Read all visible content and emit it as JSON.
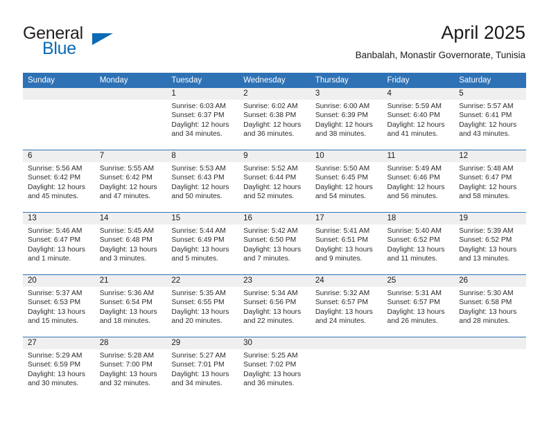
{
  "brand": {
    "name_part1": "General",
    "name_part2": "Blue",
    "triangle_color": "#0a6ab5"
  },
  "header": {
    "title": "April 2025",
    "subtitle": "Banbalah, Monastir Governorate, Tunisia"
  },
  "theme": {
    "header_blue": "#2e72b5",
    "daynum_band": "#efefef",
    "text": "#1a1a1a"
  },
  "weekday_headers": [
    "Sunday",
    "Monday",
    "Tuesday",
    "Wednesday",
    "Thursday",
    "Friday",
    "Saturday"
  ],
  "weeks": [
    [
      {
        "day": "",
        "sunrise": "",
        "sunset": "",
        "daylight1": "",
        "daylight2": ""
      },
      {
        "day": "",
        "sunrise": "",
        "sunset": "",
        "daylight1": "",
        "daylight2": ""
      },
      {
        "day": "1",
        "sunrise": "Sunrise: 6:03 AM",
        "sunset": "Sunset: 6:37 PM",
        "daylight1": "Daylight: 12 hours",
        "daylight2": "and 34 minutes."
      },
      {
        "day": "2",
        "sunrise": "Sunrise: 6:02 AM",
        "sunset": "Sunset: 6:38 PM",
        "daylight1": "Daylight: 12 hours",
        "daylight2": "and 36 minutes."
      },
      {
        "day": "3",
        "sunrise": "Sunrise: 6:00 AM",
        "sunset": "Sunset: 6:39 PM",
        "daylight1": "Daylight: 12 hours",
        "daylight2": "and 38 minutes."
      },
      {
        "day": "4",
        "sunrise": "Sunrise: 5:59 AM",
        "sunset": "Sunset: 6:40 PM",
        "daylight1": "Daylight: 12 hours",
        "daylight2": "and 41 minutes."
      },
      {
        "day": "5",
        "sunrise": "Sunrise: 5:57 AM",
        "sunset": "Sunset: 6:41 PM",
        "daylight1": "Daylight: 12 hours",
        "daylight2": "and 43 minutes."
      }
    ],
    [
      {
        "day": "6",
        "sunrise": "Sunrise: 5:56 AM",
        "sunset": "Sunset: 6:42 PM",
        "daylight1": "Daylight: 12 hours",
        "daylight2": "and 45 minutes."
      },
      {
        "day": "7",
        "sunrise": "Sunrise: 5:55 AM",
        "sunset": "Sunset: 6:42 PM",
        "daylight1": "Daylight: 12 hours",
        "daylight2": "and 47 minutes."
      },
      {
        "day": "8",
        "sunrise": "Sunrise: 5:53 AM",
        "sunset": "Sunset: 6:43 PM",
        "daylight1": "Daylight: 12 hours",
        "daylight2": "and 50 minutes."
      },
      {
        "day": "9",
        "sunrise": "Sunrise: 5:52 AM",
        "sunset": "Sunset: 6:44 PM",
        "daylight1": "Daylight: 12 hours",
        "daylight2": "and 52 minutes."
      },
      {
        "day": "10",
        "sunrise": "Sunrise: 5:50 AM",
        "sunset": "Sunset: 6:45 PM",
        "daylight1": "Daylight: 12 hours",
        "daylight2": "and 54 minutes."
      },
      {
        "day": "11",
        "sunrise": "Sunrise: 5:49 AM",
        "sunset": "Sunset: 6:46 PM",
        "daylight1": "Daylight: 12 hours",
        "daylight2": "and 56 minutes."
      },
      {
        "day": "12",
        "sunrise": "Sunrise: 5:48 AM",
        "sunset": "Sunset: 6:47 PM",
        "daylight1": "Daylight: 12 hours",
        "daylight2": "and 58 minutes."
      }
    ],
    [
      {
        "day": "13",
        "sunrise": "Sunrise: 5:46 AM",
        "sunset": "Sunset: 6:47 PM",
        "daylight1": "Daylight: 13 hours",
        "daylight2": "and 1 minute."
      },
      {
        "day": "14",
        "sunrise": "Sunrise: 5:45 AM",
        "sunset": "Sunset: 6:48 PM",
        "daylight1": "Daylight: 13 hours",
        "daylight2": "and 3 minutes."
      },
      {
        "day": "15",
        "sunrise": "Sunrise: 5:44 AM",
        "sunset": "Sunset: 6:49 PM",
        "daylight1": "Daylight: 13 hours",
        "daylight2": "and 5 minutes."
      },
      {
        "day": "16",
        "sunrise": "Sunrise: 5:42 AM",
        "sunset": "Sunset: 6:50 PM",
        "daylight1": "Daylight: 13 hours",
        "daylight2": "and 7 minutes."
      },
      {
        "day": "17",
        "sunrise": "Sunrise: 5:41 AM",
        "sunset": "Sunset: 6:51 PM",
        "daylight1": "Daylight: 13 hours",
        "daylight2": "and 9 minutes."
      },
      {
        "day": "18",
        "sunrise": "Sunrise: 5:40 AM",
        "sunset": "Sunset: 6:52 PM",
        "daylight1": "Daylight: 13 hours",
        "daylight2": "and 11 minutes."
      },
      {
        "day": "19",
        "sunrise": "Sunrise: 5:39 AM",
        "sunset": "Sunset: 6:52 PM",
        "daylight1": "Daylight: 13 hours",
        "daylight2": "and 13 minutes."
      }
    ],
    [
      {
        "day": "20",
        "sunrise": "Sunrise: 5:37 AM",
        "sunset": "Sunset: 6:53 PM",
        "daylight1": "Daylight: 13 hours",
        "daylight2": "and 15 minutes."
      },
      {
        "day": "21",
        "sunrise": "Sunrise: 5:36 AM",
        "sunset": "Sunset: 6:54 PM",
        "daylight1": "Daylight: 13 hours",
        "daylight2": "and 18 minutes."
      },
      {
        "day": "22",
        "sunrise": "Sunrise: 5:35 AM",
        "sunset": "Sunset: 6:55 PM",
        "daylight1": "Daylight: 13 hours",
        "daylight2": "and 20 minutes."
      },
      {
        "day": "23",
        "sunrise": "Sunrise: 5:34 AM",
        "sunset": "Sunset: 6:56 PM",
        "daylight1": "Daylight: 13 hours",
        "daylight2": "and 22 minutes."
      },
      {
        "day": "24",
        "sunrise": "Sunrise: 5:32 AM",
        "sunset": "Sunset: 6:57 PM",
        "daylight1": "Daylight: 13 hours",
        "daylight2": "and 24 minutes."
      },
      {
        "day": "25",
        "sunrise": "Sunrise: 5:31 AM",
        "sunset": "Sunset: 6:57 PM",
        "daylight1": "Daylight: 13 hours",
        "daylight2": "and 26 minutes."
      },
      {
        "day": "26",
        "sunrise": "Sunrise: 5:30 AM",
        "sunset": "Sunset: 6:58 PM",
        "daylight1": "Daylight: 13 hours",
        "daylight2": "and 28 minutes."
      }
    ],
    [
      {
        "day": "27",
        "sunrise": "Sunrise: 5:29 AM",
        "sunset": "Sunset: 6:59 PM",
        "daylight1": "Daylight: 13 hours",
        "daylight2": "and 30 minutes."
      },
      {
        "day": "28",
        "sunrise": "Sunrise: 5:28 AM",
        "sunset": "Sunset: 7:00 PM",
        "daylight1": "Daylight: 13 hours",
        "daylight2": "and 32 minutes."
      },
      {
        "day": "29",
        "sunrise": "Sunrise: 5:27 AM",
        "sunset": "Sunset: 7:01 PM",
        "daylight1": "Daylight: 13 hours",
        "daylight2": "and 34 minutes."
      },
      {
        "day": "30",
        "sunrise": "Sunrise: 5:25 AM",
        "sunset": "Sunset: 7:02 PM",
        "daylight1": "Daylight: 13 hours",
        "daylight2": "and 36 minutes."
      },
      {
        "day": "",
        "sunrise": "",
        "sunset": "",
        "daylight1": "",
        "daylight2": ""
      },
      {
        "day": "",
        "sunrise": "",
        "sunset": "",
        "daylight1": "",
        "daylight2": ""
      },
      {
        "day": "",
        "sunrise": "",
        "sunset": "",
        "daylight1": "",
        "daylight2": ""
      }
    ]
  ]
}
